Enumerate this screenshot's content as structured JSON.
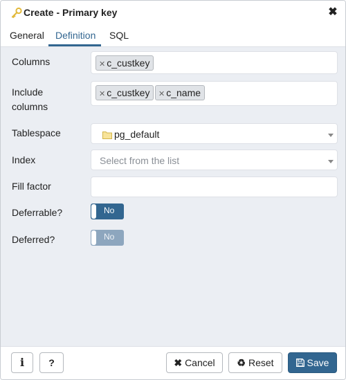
{
  "dialog": {
    "title": "Create - Primary key",
    "title_icon": "key-icon",
    "close_icon": "close-icon"
  },
  "tabs": [
    {
      "label": "General"
    },
    {
      "label": "Definition"
    },
    {
      "label": "SQL"
    }
  ],
  "active_tab": "Definition",
  "form": {
    "columns": {
      "label": "Columns",
      "chips": [
        "c_custkey"
      ]
    },
    "include_columns": {
      "label_line1": "Include",
      "label_line2": "columns",
      "chips": [
        "c_custkey",
        "c_name"
      ]
    },
    "tablespace": {
      "label": "Tablespace",
      "value": "pg_default",
      "icon": "folder-icon"
    },
    "index": {
      "label": "Index",
      "placeholder": "Select from the list"
    },
    "fill_factor": {
      "label": "Fill factor",
      "value": ""
    },
    "deferrable": {
      "label": "Deferrable?",
      "value": "No"
    },
    "deferred": {
      "label": "Deferred?",
      "value": "No"
    }
  },
  "footer": {
    "info_icon": "info-icon",
    "help_label": "?",
    "cancel_label": "Cancel",
    "reset_label": "Reset",
    "save_label": "Save"
  },
  "colors": {
    "accent": "#326690",
    "content_bg": "#ebeef3"
  }
}
